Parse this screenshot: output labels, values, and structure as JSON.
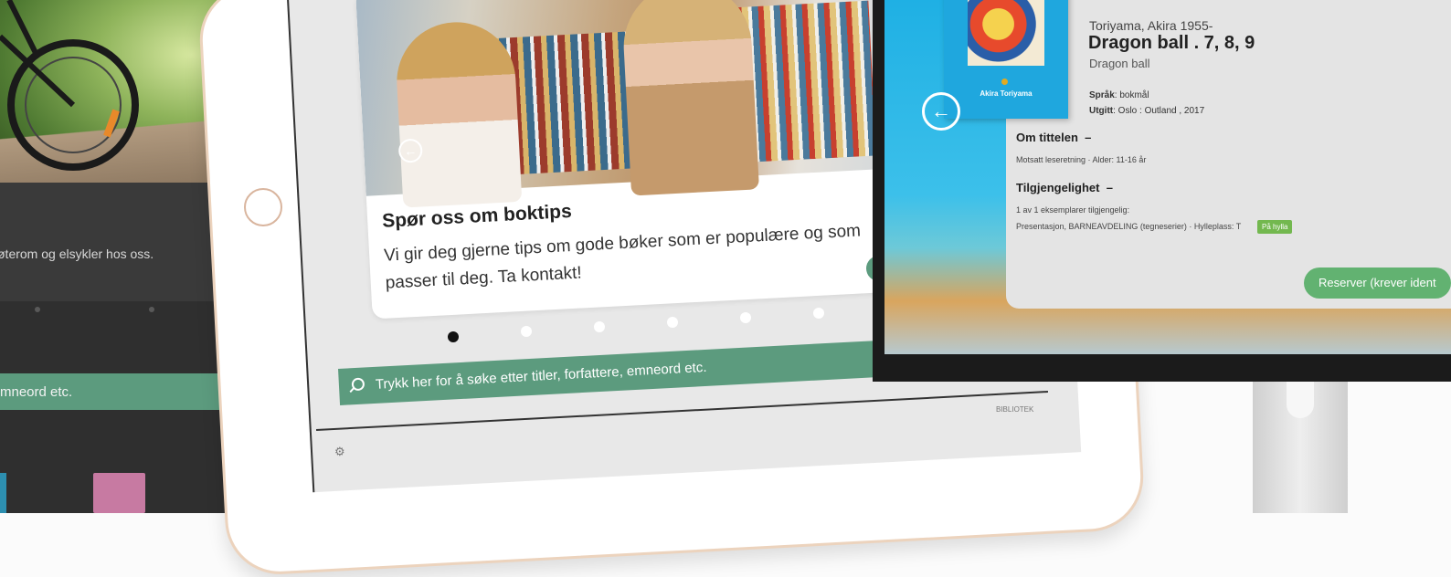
{
  "left_screen": {
    "promo_text": "øterom og elsykler hos oss.",
    "search_text": "mneord etc."
  },
  "tablet": {
    "card": {
      "title": "Spør oss om boktips",
      "body": "Vi gir deg gjerne tips om gode bøker som er populære og som passer til deg. Ta kontakt!"
    },
    "carousel": {
      "count": 6,
      "active_index": 0
    },
    "search_text": "Trykk her for å søke etter titler, forfattere, emneord etc.",
    "footer_logo_text": "BIBLIOTEK"
  },
  "monitor": {
    "book_cover_label": "Akira Toriyama",
    "author": "Toriyama, Akira 1955-",
    "title": "Dragon ball . 7, 8, 9",
    "series": "Dragon ball",
    "language_label": "Språk",
    "language_value": ": bokmål",
    "published_label": "Utgitt",
    "published_value": ": Oslo : Outland , 2017",
    "about_heading": "Om tittelen",
    "about_toggle": "–",
    "about_note": "Motsatt leseretning · Alder: 11-16 år",
    "availability_heading": "Tilgjengelighet",
    "availability_toggle": "–",
    "availability_count": "1 av 1 eksemplarer tilgjengelig:",
    "availability_location": "Presentasjon, BARNEAVDELING (tegneserier) · Hylleplass: T",
    "availability_badge": "På hylla",
    "reserve_button": "Reserver (krever ident"
  },
  "colors": {
    "green": "#5c9b7e",
    "reserve_green": "#62b271",
    "badge_green": "#73b84f",
    "monitor_blue": "#1fb0e4"
  }
}
